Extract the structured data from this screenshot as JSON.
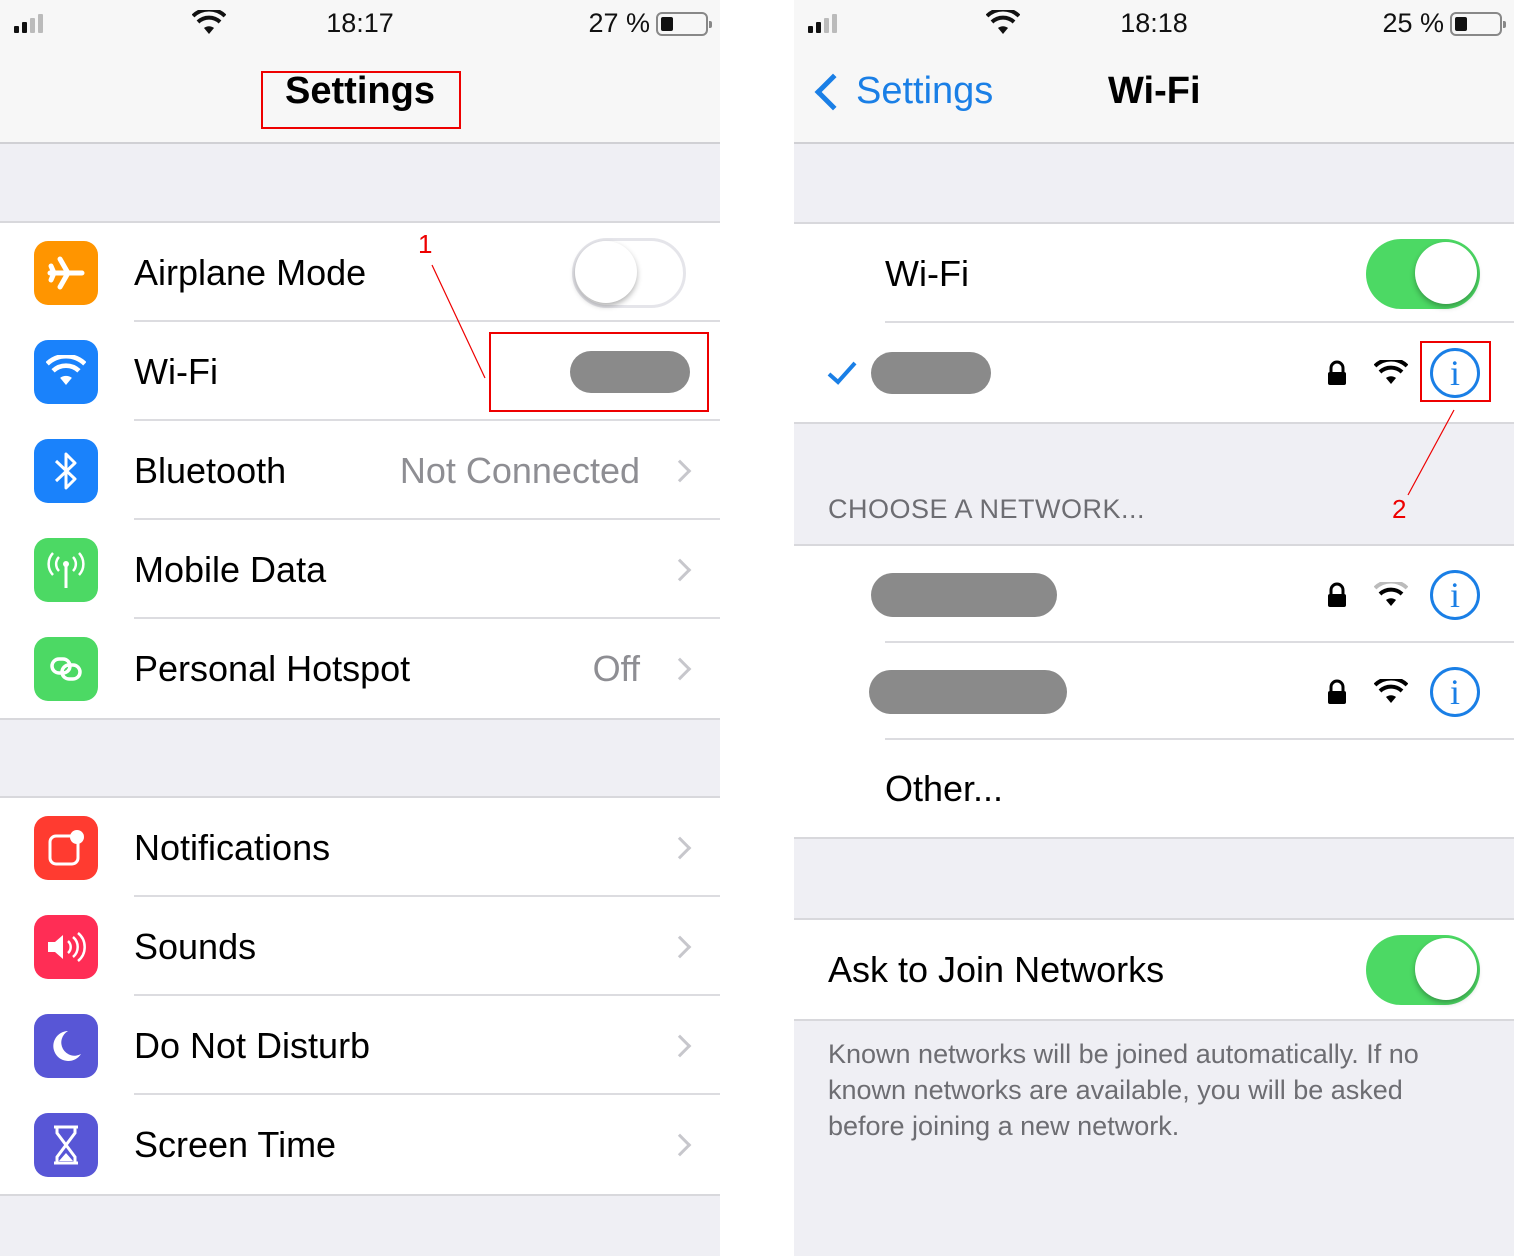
{
  "left": {
    "status": {
      "time": "18:17",
      "battery": "27 %"
    },
    "nav_title": "Settings",
    "annotation": "1",
    "group1": [
      {
        "label": "Airplane Mode",
        "icon": "airplane-icon",
        "color": "#ff9500",
        "control": "toggle",
        "toggle_on": false
      },
      {
        "label": "Wi-Fi",
        "icon": "wifi-icon",
        "color": "#1a82fb",
        "value_redacted": true
      },
      {
        "label": "Bluetooth",
        "icon": "bluetooth-icon",
        "color": "#1a82fb",
        "value": "Not Connected"
      },
      {
        "label": "Mobile Data",
        "icon": "antenna-icon",
        "color": "#4cd964",
        "value": ""
      },
      {
        "label": "Personal Hotspot",
        "icon": "hotspot-icon",
        "color": "#4cd964",
        "value": "Off"
      }
    ],
    "group2": [
      {
        "label": "Notifications",
        "icon": "notifications-icon",
        "color": "#ff3b30"
      },
      {
        "label": "Sounds",
        "icon": "speaker-icon",
        "color": "#ff2d55"
      },
      {
        "label": "Do Not Disturb",
        "icon": "moon-icon",
        "color": "#5856d6"
      },
      {
        "label": "Screen Time",
        "icon": "hourglass-icon",
        "color": "#5856d6"
      }
    ]
  },
  "right": {
    "status": {
      "time": "18:18",
      "battery": "25 %"
    },
    "back_label": "Settings",
    "nav_title": "Wi-Fi",
    "annotation": "2",
    "wifi_label": "Wi-Fi",
    "wifi_on": true,
    "section_header": "CHOOSE A NETWORK...",
    "networks": [
      {
        "name_redacted": true,
        "secured": true,
        "signal": "medium"
      },
      {
        "name_redacted": true,
        "secured": true,
        "signal": "full"
      }
    ],
    "other_label": "Other...",
    "ask_join_label": "Ask to Join Networks",
    "ask_join_on": true,
    "footer": "Known networks will be joined automatically. If no known networks are available, you will be asked before joining a new network.",
    "accent": "#1a7fe6"
  }
}
